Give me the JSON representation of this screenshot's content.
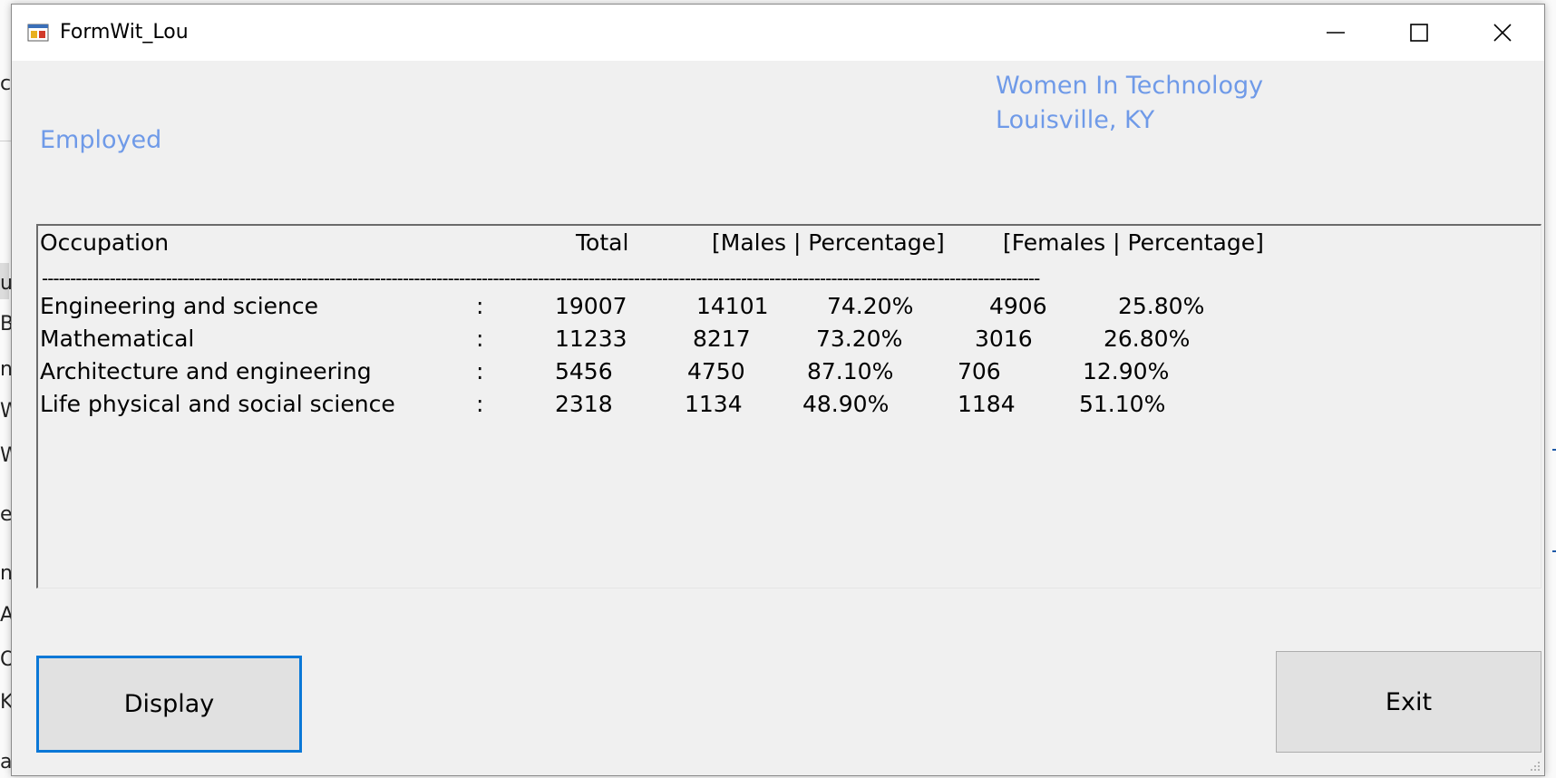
{
  "window": {
    "title": "FormWit_Lou",
    "controls": {
      "minimize_icon": "minimize-icon",
      "maximize_icon": "maximize-icon",
      "close_icon": "close-icon"
    }
  },
  "labels": {
    "status": "Employed",
    "org_line1": "Women In Technology",
    "org_line2": "Louisville, KY"
  },
  "listbox": {
    "header": {
      "occupation": "Occupation",
      "total": "Total",
      "males": "[Males | Percentage]",
      "females": "[Females | Percentage]"
    },
    "divider": "---------------------------------------------------------------------------------------------------------------------------------------------------------------------------------",
    "rows": [
      {
        "occupation": "Engineering and science",
        "sep": ":",
        "total": "19007",
        "males": "14101",
        "male_pct": "74.20%",
        "females": "4906",
        "female_pct": "25.80%"
      },
      {
        "occupation": "Mathematical",
        "sep": ":",
        "total": "11233",
        "males": "8217",
        "male_pct": "73.20%",
        "females": "3016",
        "female_pct": "26.80%"
      },
      {
        "occupation": "Architecture and engineering",
        "sep": ":",
        "total": "5456",
        "males": "4750",
        "male_pct": "87.10%",
        "females": "706",
        "female_pct": "12.90%"
      },
      {
        "occupation": "Life physical and social science",
        "sep": ":",
        "total": "2318",
        "males": "1134",
        "male_pct": "48.90%",
        "females": "1184",
        "female_pct": "51.10%"
      }
    ]
  },
  "buttons": {
    "display": "Display",
    "exit": "Exit"
  },
  "background_fragments": [
    "c",
    "u",
    "Bi",
    "n",
    "W",
    "W",
    "e",
    "n",
    "A",
    "O",
    "K",
    "ai"
  ]
}
